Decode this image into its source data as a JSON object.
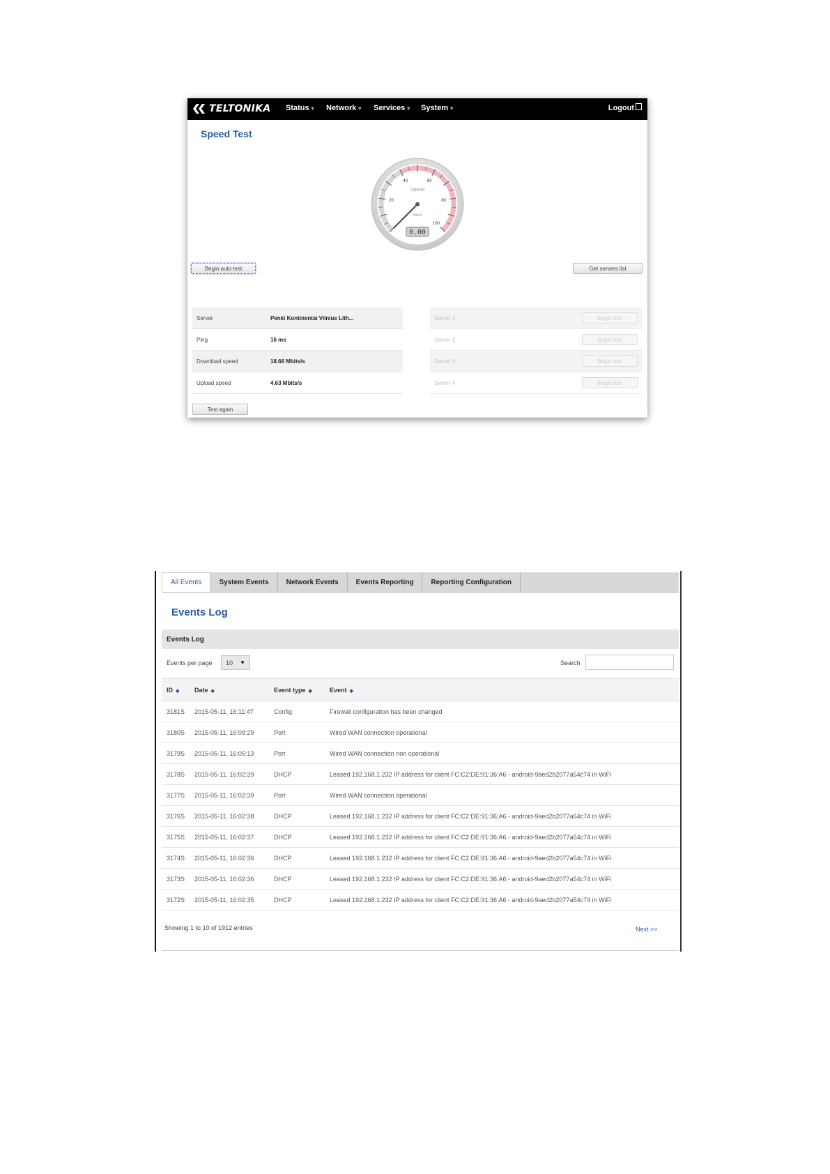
{
  "speed_test": {
    "brand": "TELTONIKA",
    "nav": [
      {
        "label": "Status"
      },
      {
        "label": "Network"
      },
      {
        "label": "Services"
      },
      {
        "label": "System"
      }
    ],
    "logout_label": "Logout",
    "page_title": "Speed Test",
    "gauge": {
      "label": "Speed",
      "unit": "Mbit/s",
      "value": "0.00",
      "ticks": [
        "20",
        "40",
        "60",
        "80",
        "100"
      ],
      "needle_value": 0,
      "max": 100,
      "redzone_start": 40
    },
    "begin_auto_label": "Begin auto test",
    "get_servers_label": "Get servers list",
    "results": [
      {
        "label": "Server",
        "value": "Penki Kontinentai Vilnius Lith..."
      },
      {
        "label": "Ping",
        "value": "16 ms"
      },
      {
        "label": "Download speed",
        "value": "18.66 Mbits/s"
      },
      {
        "label": "Upload speed",
        "value": "4.63 Mbits/s"
      }
    ],
    "servers": [
      {
        "label": "Server 1",
        "button": "Begin test"
      },
      {
        "label": "Server 2",
        "button": "Begin test"
      },
      {
        "label": "Server 3",
        "button": "Begin test"
      },
      {
        "label": "Server 4",
        "button": "Begin test"
      }
    ],
    "test_again_label": "Test again"
  },
  "events_log": {
    "tabs": [
      {
        "label": "All Events",
        "active": true
      },
      {
        "label": "System Events",
        "active": false
      },
      {
        "label": "Network Events",
        "active": false
      },
      {
        "label": "Events Reporting",
        "active": false
      },
      {
        "label": "Reporting Configuration",
        "active": false
      }
    ],
    "title": "Events Log",
    "section_label": "Events Log",
    "per_page_label": "Events per page",
    "per_page_value": "10",
    "search_label": "Search",
    "search_value": "",
    "columns": [
      "ID",
      "Date",
      "Event type",
      "Event"
    ],
    "rows": [
      {
        "id": "3181S",
        "date": "2015-05-11, 16:11:47",
        "type": "Config",
        "event": "Firewall configuration has been changed"
      },
      {
        "id": "3180S",
        "date": "2015-05-11, 16:09:29",
        "type": "Port",
        "event": "Wired WAN connection operational"
      },
      {
        "id": "3179S",
        "date": "2015-05-11, 16:05:13",
        "type": "Port",
        "event": "Wired WAN connection non operational"
      },
      {
        "id": "3178S",
        "date": "2015-05-11, 16:02:39",
        "type": "DHCP",
        "event": "Leased 192.168.1.232 IP address for client FC:C2:DE:91:36:A6 - android-9aed2b2077a54c74 in WiFi"
      },
      {
        "id": "3177S",
        "date": "2015-05-11, 16:02:39",
        "type": "Port",
        "event": "Wired WAN connection operational"
      },
      {
        "id": "3176S",
        "date": "2015-05-11, 16:02:38",
        "type": "DHCP",
        "event": "Leased 192.168.1.232 IP address for client FC:C2:DE:91:36:A6 - android-9aed2b2077a54c74 in WiFi"
      },
      {
        "id": "3175S",
        "date": "2015-05-11, 16:02:37",
        "type": "DHCP",
        "event": "Leased 192.168.1.232 IP address for client FC:C2:DE:91:36:A6 - android-9aed2b2077a54c74 in WiFi"
      },
      {
        "id": "3174S",
        "date": "2015-05-11, 16:02:36",
        "type": "DHCP",
        "event": "Leased 192.168.1.232 IP address for client FC:C2:DE:91:36:A6 - android-9aed2b2077a54c74 in WiFi"
      },
      {
        "id": "3173S",
        "date": "2015-05-11, 16:02:36",
        "type": "DHCP",
        "event": "Leased 192.168.1.232 IP address for client FC:C2:DE:91:36:A6 - android-9aed2b2077a54c74 in WiFi"
      },
      {
        "id": "3172S",
        "date": "2015-05-11, 16:02:35",
        "type": "DHCP",
        "event": "Leased 192.168.1.232 IP address for client FC:C2:DE:91:36:A6 - android-9aed2b2077a54c74 in WiFi"
      }
    ],
    "showing_text": "Showing 1 to 10 of 1912 entries",
    "next_label": "Next >>"
  },
  "colors": {
    "accent_blue": "#2a5aa0",
    "topbar": "#000000",
    "gauge_redzone": "#f0b6bc"
  },
  "icons": [
    "teltonika-logo-icon",
    "caret-down-icon",
    "logout-icon",
    "sort-arrow-icon",
    "select-arrow-icon"
  ]
}
